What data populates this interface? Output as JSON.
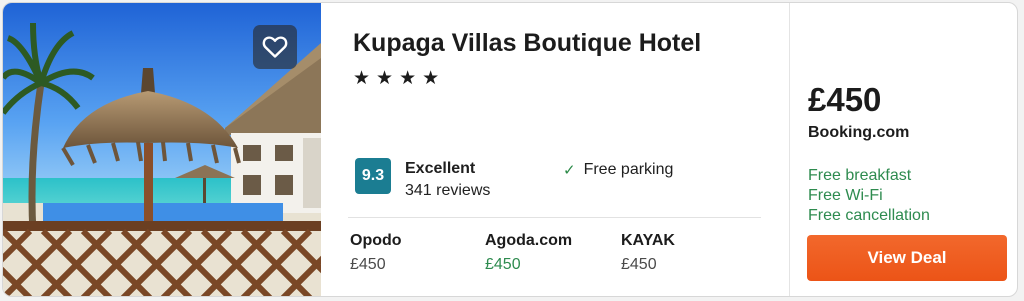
{
  "hotel": {
    "name": "Kupaga Villas Boutique Hotel",
    "stars": 4,
    "star_glyph": "★"
  },
  "rating": {
    "score": "9.3",
    "label": "Excellent",
    "reviews": "341 reviews",
    "badge_color": "#1b7d92"
  },
  "amenity": {
    "check_glyph": "✓",
    "label": "Free parking"
  },
  "providers": [
    {
      "name": "Opodo",
      "price": "£450"
    },
    {
      "name": "Agoda.com",
      "price": "£450"
    },
    {
      "name": "KAYAK",
      "price": "£450"
    }
  ],
  "deal": {
    "price": "£450",
    "provider": "Booking.com",
    "perks": [
      "Free breakfast",
      "Free Wi-Fi",
      "Free cancellation"
    ],
    "button_label": "View Deal",
    "button_color": "#f15d24",
    "perk_color": "#2e8b4f"
  },
  "icons": {
    "favorite": "heart-icon",
    "check": "check-icon"
  }
}
